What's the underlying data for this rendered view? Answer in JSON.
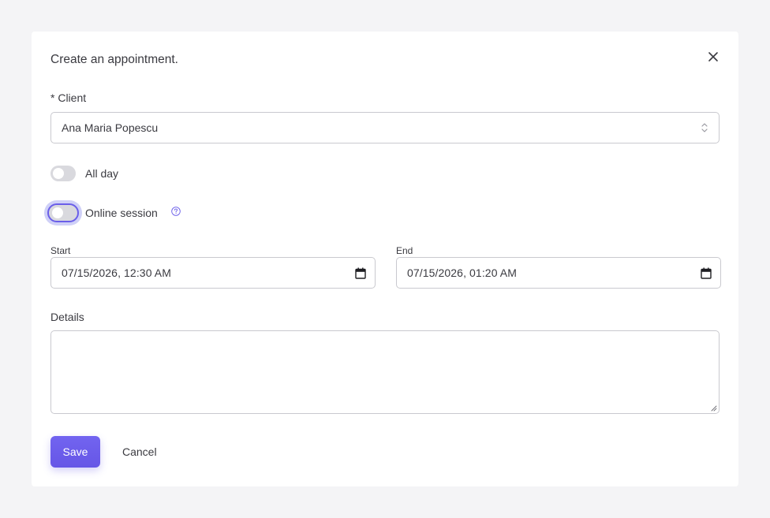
{
  "dialog": {
    "title": "Create an appointment."
  },
  "form": {
    "client": {
      "label": "* Client",
      "value": "Ana Maria Popescu"
    },
    "all_day": {
      "label": "All day",
      "checked": false
    },
    "online_session": {
      "label": "Online session",
      "checked": false,
      "help_icon": "question-circle-icon"
    },
    "start": {
      "label": "Start",
      "value": "07/15/2026, 12:30 AM"
    },
    "end": {
      "label": "End",
      "value": "07/15/2026, 01:20 AM"
    },
    "details": {
      "label": "Details",
      "value": ""
    }
  },
  "actions": {
    "save_label": "Save",
    "cancel_label": "Cancel"
  },
  "colors": {
    "accent": "#6c5ce7",
    "focus_ring": "#cfd0f7",
    "help_icon": "#6a5ee9"
  }
}
